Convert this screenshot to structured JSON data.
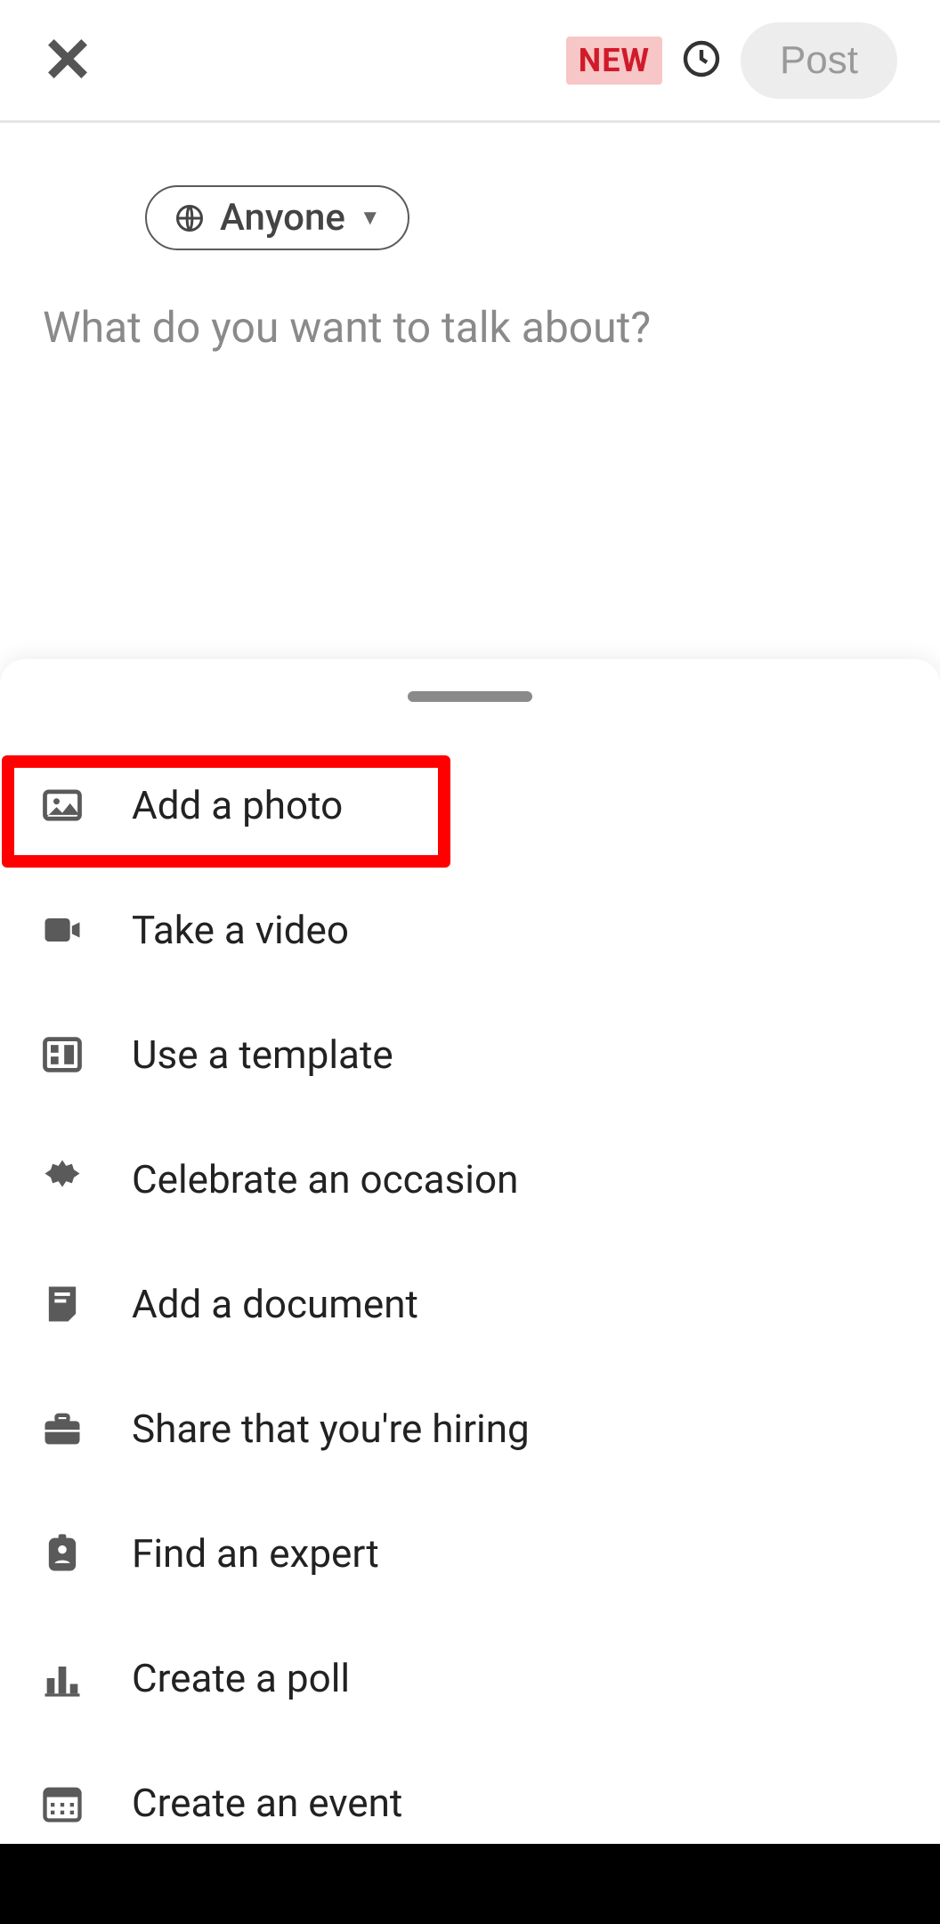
{
  "header": {
    "new_badge": "NEW",
    "post_button": "Post"
  },
  "audience": {
    "label": "Anyone"
  },
  "composer": {
    "placeholder": "What do you want to talk about?"
  },
  "sheet": {
    "options": [
      {
        "icon": "image-icon",
        "label": "Add a photo"
      },
      {
        "icon": "video-icon",
        "label": "Take a video"
      },
      {
        "icon": "template-icon",
        "label": "Use a template"
      },
      {
        "icon": "celebrate-icon",
        "label": "Celebrate an occasion"
      },
      {
        "icon": "document-icon",
        "label": "Add a document"
      },
      {
        "icon": "briefcase-icon",
        "label": "Share that you're hiring"
      },
      {
        "icon": "expert-icon",
        "label": "Find an expert"
      },
      {
        "icon": "poll-icon",
        "label": "Create a poll"
      },
      {
        "icon": "event-icon",
        "label": "Create an event"
      }
    ]
  }
}
